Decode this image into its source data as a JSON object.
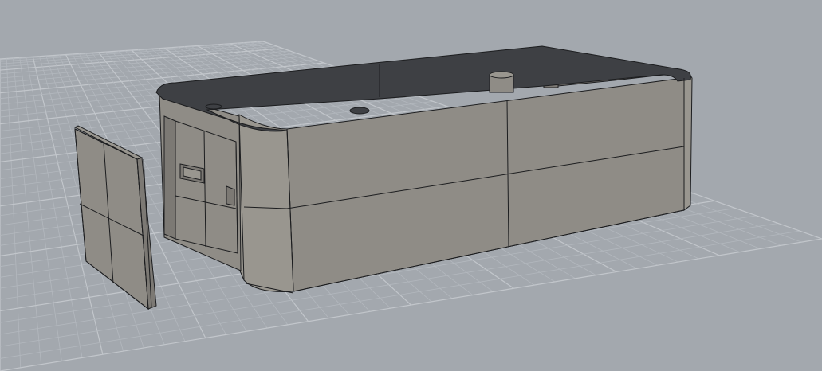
{
  "viewport": {
    "view": "perspective",
    "display_mode": "shaded",
    "colors": {
      "background": "#a3a8ae",
      "grid_minor": "#b3b8be",
      "grid_major": "#c2c6cb",
      "model_face": "#8f8c86",
      "model_face_light": "#99968f",
      "model_face_dark": "#7c7974",
      "rim": "#3e4044",
      "edge": "#1c1d1f"
    }
  },
  "scene": {
    "objects": [
      {
        "name": "enclosure-box",
        "kind": "open rounded box with lip"
      },
      {
        "name": "end-cap-panel",
        "kind": "separate end panel"
      }
    ]
  }
}
